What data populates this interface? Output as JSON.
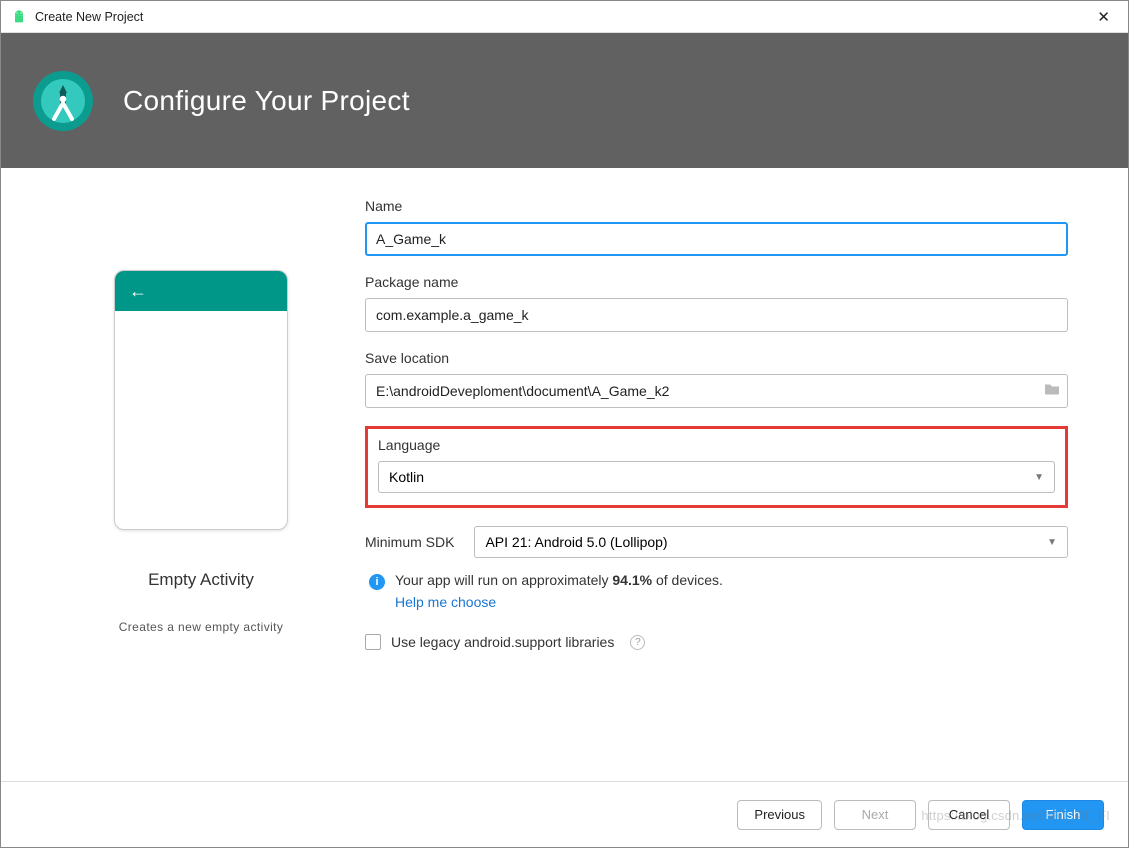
{
  "titlebar": {
    "title": "Create New Project"
  },
  "header": {
    "title": "Configure Your Project"
  },
  "preview": {
    "title": "Empty Activity",
    "description": "Creates a new empty activity"
  },
  "form": {
    "name": {
      "label": "Name",
      "value": "A_Game_k"
    },
    "package": {
      "label": "Package name",
      "value": "com.example.a_game_k"
    },
    "location": {
      "label": "Save location",
      "value": "E:\\androidDeveploment\\document\\A_Game_k2"
    },
    "language": {
      "label": "Language",
      "value": "Kotlin"
    },
    "minsdk": {
      "label": "Minimum SDK",
      "value": "API 21: Android 5.0 (Lollipop)"
    },
    "info_prefix": "Your app will run on approximately ",
    "info_pct": "94.1%",
    "info_suffix": " of devices.",
    "help_link": "Help me choose",
    "legacy_label": "Use legacy android.support libraries"
  },
  "footer": {
    "previous": "Previous",
    "next": "Next",
    "cancel": "Cancel",
    "finish": "Finish"
  },
  "watermark": "https://blog.csdn.net/MO_AT_FI"
}
